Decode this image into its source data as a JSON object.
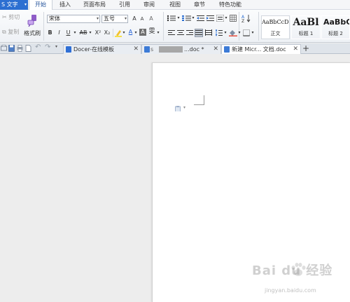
{
  "app": {
    "button_label": "S 文字",
    "caret": "▾"
  },
  "menu": [
    {
      "label": "开始",
      "active": true
    },
    {
      "label": "插入"
    },
    {
      "label": "页面布局"
    },
    {
      "label": "引用"
    },
    {
      "label": "审阅"
    },
    {
      "label": "视图"
    },
    {
      "label": "章节"
    },
    {
      "label": "特色功能"
    }
  ],
  "clipboard": {
    "cut": "剪切",
    "copy": "复制",
    "format_painter": "格式刷"
  },
  "font": {
    "family": "宋体",
    "size": "五号"
  },
  "format_buttons": {
    "bold": "B",
    "italic": "I",
    "underline": "U",
    "strike": "AB",
    "superscript": "X²",
    "subscript": "X₂",
    "font_color": "A",
    "char_shade": "A",
    "grow": "A",
    "shrink": "A",
    "clear": "A"
  },
  "styles": [
    {
      "sample": "AaBbCcDd",
      "label": "正文"
    },
    {
      "sample": "AaBl",
      "label": "标题 1"
    },
    {
      "sample": "AaBbC",
      "label": "标题 2"
    }
  ],
  "tabs": [
    {
      "label": "Docer-在线模板",
      "close": "✕"
    },
    {
      "label": "...doc *",
      "close": "✕",
      "prefix": "s"
    },
    {
      "label": "新建 Micr... 文档.doc",
      "close": "✕",
      "active": true
    }
  ],
  "new_tab": "+",
  "watermark": {
    "brand": "Bai du 经验",
    "url": "jingyan.baidu.com"
  },
  "colors": {
    "accent": "#2c6fd1",
    "page": "#ffffff",
    "workspace": "#ededed"
  }
}
